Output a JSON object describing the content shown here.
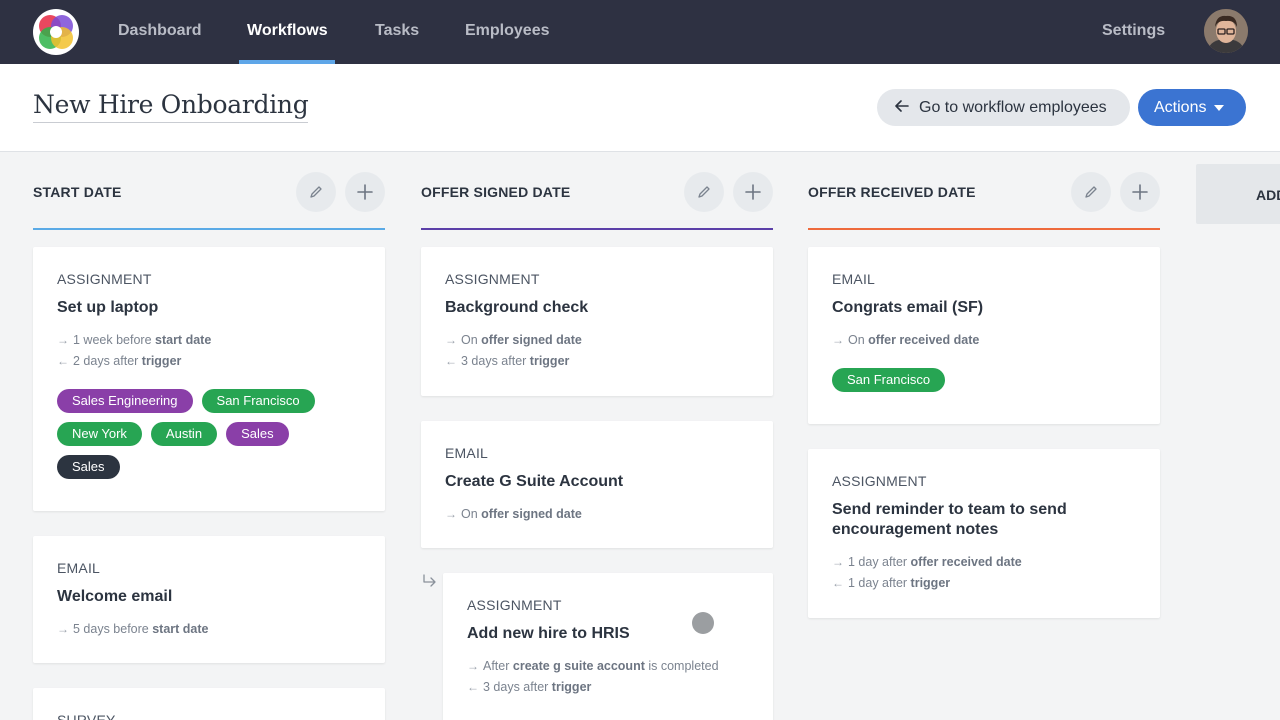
{
  "nav": {
    "items": [
      {
        "label": "Dashboard"
      },
      {
        "label": "Workflows"
      },
      {
        "label": "Tasks"
      },
      {
        "label": "Employees"
      }
    ],
    "settings_label": "Settings"
  },
  "header": {
    "title": "New Hire Onboarding",
    "go_button_label": "Go to workflow employees",
    "actions_button_label": "Actions"
  },
  "columns": [
    {
      "title": "START DATE",
      "accent_color": "#5aaae6",
      "cards": [
        {
          "type": "ASSIGNMENT",
          "title": "Set up laptop",
          "meta": [
            {
              "pre": "1 week before ",
              "bold": "start date",
              "post": ""
            },
            {
              "pre": "2 days after ",
              "bold": "trigger",
              "post": ""
            }
          ],
          "tags": [
            {
              "label": "Sales Engineering",
              "color": "#8a3fa8"
            },
            {
              "label": "San Francisco",
              "color": "#27a553"
            },
            {
              "label": "New York",
              "color": "#27a553"
            },
            {
              "label": "Austin",
              "color": "#27a553"
            },
            {
              "label": "Sales",
              "color": "#8a3fa8"
            },
            {
              "label": "Sales",
              "color": "#2c3440"
            }
          ]
        },
        {
          "type": "EMAIL",
          "title": "Welcome email",
          "meta": [
            {
              "pre": "5 days before ",
              "bold": "start date",
              "post": ""
            }
          ]
        },
        {
          "type": "SURVEY"
        }
      ]
    },
    {
      "title": "OFFER SIGNED DATE",
      "accent_color": "#5b3fa8",
      "cards": [
        {
          "type": "ASSIGNMENT",
          "title": "Background check",
          "meta": [
            {
              "pre": "On ",
              "bold": "offer signed date",
              "post": ""
            },
            {
              "pre": "3 days after ",
              "bold": "trigger",
              "post": ""
            }
          ]
        },
        {
          "type": "EMAIL",
          "title": "Create G Suite Account",
          "meta": [
            {
              "pre": "On ",
              "bold": "offer signed date",
              "post": ""
            }
          ]
        },
        {
          "type": "ASSIGNMENT",
          "title": "Add new hire to HRIS",
          "meta": [
            {
              "pre": "After ",
              "bold": "create g suite account",
              "post": " is completed"
            },
            {
              "pre": "3 days after ",
              "bold": "trigger",
              "post": ""
            }
          ]
        }
      ]
    },
    {
      "title": "OFFER RECEIVED DATE",
      "accent_color": "#ee6a3c",
      "cards": [
        {
          "type": "EMAIL",
          "title": "Congrats email (SF)",
          "meta": [
            {
              "pre": "On ",
              "bold": "offer received date",
              "post": ""
            }
          ],
          "tags": [
            {
              "label": "San Francisco",
              "color": "#27a553"
            }
          ]
        },
        {
          "type": "ASSIGNMENT",
          "title": "Send reminder to team to send encouragement notes",
          "meta": [
            {
              "pre": "1 day after ",
              "bold": "offer received date",
              "post": ""
            },
            {
              "pre": "1 day after ",
              "bold": "trigger",
              "post": ""
            }
          ]
        }
      ]
    }
  ],
  "add_column_label": "ADD"
}
